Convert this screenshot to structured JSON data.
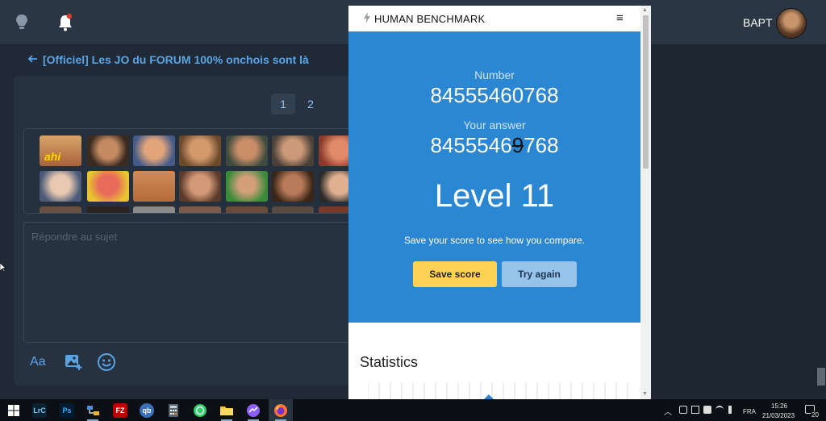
{
  "topbar": {
    "username": "BAPT",
    "bulb_icon": "lightbulb-icon",
    "bell_icon": "bell-icon"
  },
  "forum": {
    "topic_title": "[Officiel] Les JO du FORUM 100% onchois sont là",
    "pagination": [
      "1",
      "2"
    ],
    "reply_placeholder": "Répondre au sujet",
    "sticker_first": "ahi",
    "tools": {
      "text_format_label": "Aa",
      "image_icon": "image-add-icon",
      "emoji_icon": "emoji-icon"
    }
  },
  "benchmark": {
    "brand": "HUMAN BENCHMARK",
    "menu_glyph": "≡",
    "number_label": "Number",
    "number_value": "84555460768",
    "answer_label": "Your answer",
    "answer_prefix": "8455546",
    "answer_wrong_digit": "9",
    "answer_suffix": "768",
    "level_text": "Level 11",
    "description": "Save your score to see how you compare.",
    "save_button": "Save score",
    "try_button": "Try again",
    "stats_heading": "Statistics",
    "colors": {
      "main_bg": "#2b87d1",
      "save_bg": "#ffd154",
      "try_bg": "#95c3ea"
    }
  },
  "taskbar": {
    "apps": [
      {
        "name": "windows-start",
        "label": ""
      },
      {
        "name": "lightroom",
        "label": "LrC"
      },
      {
        "name": "photoshop",
        "label": "Ps"
      },
      {
        "name": "network-app",
        "label": ""
      },
      {
        "name": "filezilla",
        "label": "FZ"
      },
      {
        "name": "qbittorrent",
        "label": "qb"
      },
      {
        "name": "calculator",
        "label": ""
      },
      {
        "name": "whatsapp",
        "label": ""
      },
      {
        "name": "file-explorer",
        "label": ""
      },
      {
        "name": "messenger",
        "label": ""
      },
      {
        "name": "firefox",
        "label": ""
      }
    ],
    "language": "FRA",
    "time": "15:26",
    "date": "21/03/2023",
    "notification_count": "20"
  }
}
